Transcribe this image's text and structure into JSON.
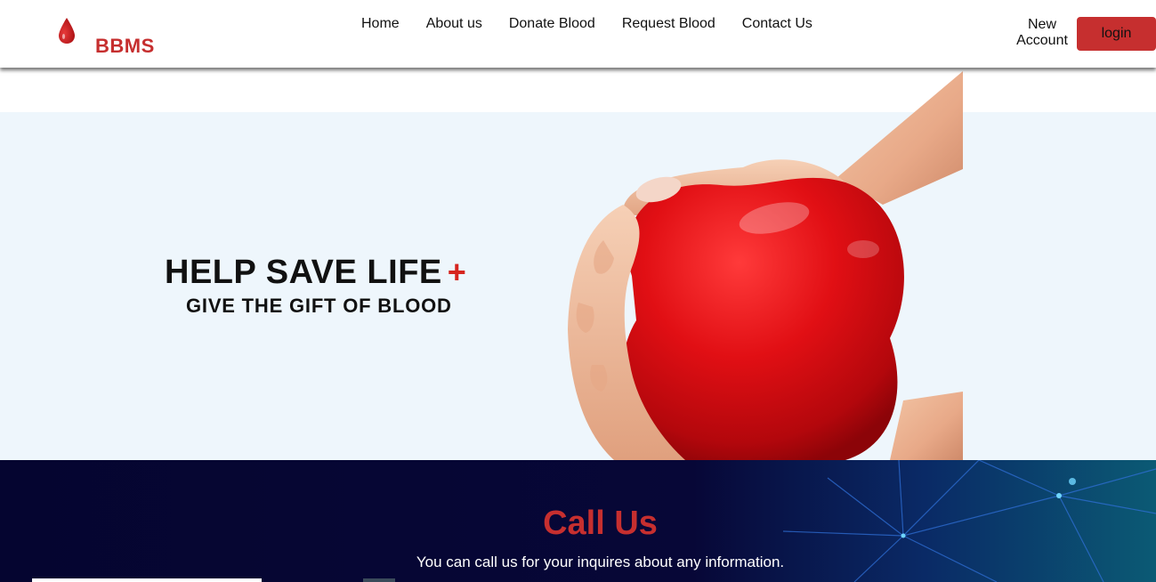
{
  "brand": {
    "name": "BBMS",
    "color": "#c62f2f"
  },
  "nav": {
    "items": [
      {
        "label": "Home"
      },
      {
        "label": "About us"
      },
      {
        "label": "Donate Blood"
      },
      {
        "label": "Request Blood"
      },
      {
        "label": "Contact Us"
      }
    ]
  },
  "account": {
    "new_account_label": "New Account",
    "login_label": "login"
  },
  "hero": {
    "title": "HELP SAVE LIFE",
    "plus": "+",
    "subtitle": "GIVE THE GIFT OF BLOOD",
    "background": "#eef6fc",
    "image_icon": "heart-in-hands-illustration"
  },
  "call_us": {
    "title": "Call Us",
    "text": "You can call us for your inquires about any information.",
    "background": "#050530"
  },
  "icons": {
    "logo": "blood-drop-icon"
  }
}
